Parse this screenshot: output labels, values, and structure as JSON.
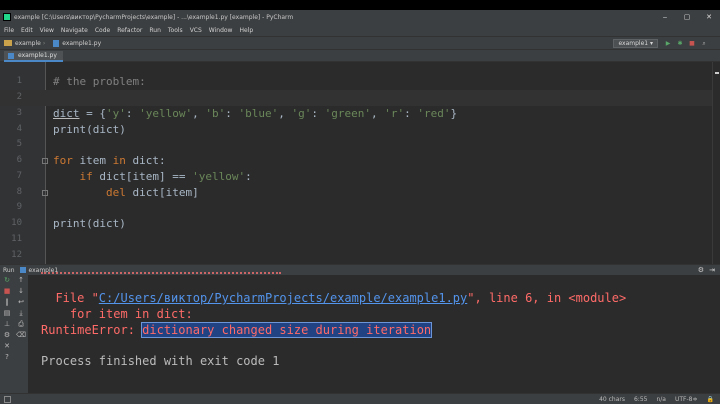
{
  "window": {
    "title": "example [C:\\Users\\виктор\\PycharmProjects\\example] - ...\\example1.py [example] - PyCharm",
    "minimize": "‒",
    "maximize": "▢",
    "close": "✕"
  },
  "menu": [
    "File",
    "Edit",
    "View",
    "Navigate",
    "Code",
    "Refactor",
    "Run",
    "Tools",
    "VCS",
    "Window",
    "Help"
  ],
  "breadcrumb": {
    "project": "example",
    "file": "example1.py"
  },
  "run_config": "example1 ▾",
  "tab": {
    "label": "example1.py"
  },
  "editor": {
    "line_numbers": [
      "1",
      "2",
      "3",
      "4",
      "5",
      "6",
      "7",
      "8",
      "9",
      "10",
      "11",
      "12"
    ],
    "lines": {
      "l1_comment": "# the problem:",
      "l3_var": "dict",
      "l3_eq": " = {",
      "l3_s1": "'y'",
      "l3_c1": ": ",
      "l3_s2": "'yellow'",
      "l3_c2": ", ",
      "l3_s3": "'b'",
      "l3_c3": ": ",
      "l3_s4": "'blue'",
      "l3_c4": ", ",
      "l3_s5": "'g'",
      "l3_c5": ": ",
      "l3_s6": "'green'",
      "l3_c6": ", ",
      "l3_s7": "'r'",
      "l3_c7": ": ",
      "l3_s8": "'red'",
      "l3_end": "}",
      "l4": "print(dict)",
      "l6_for": "for",
      "l6_mid": " item ",
      "l6_in": "in",
      "l6_end": " dict:",
      "l7_if": "    if",
      "l7_mid": " dict[item] == ",
      "l7_str": "'yellow'",
      "l7_end": ":",
      "l8_del": "        del",
      "l8_end": " dict[item]",
      "l10": "print(dict)"
    }
  },
  "run_panel": {
    "label": "Run",
    "config": "example1"
  },
  "console": {
    "file_prefix": "  File \"",
    "file_link": "C:/Users/виктор/PycharmProjects/example/example1.py",
    "file_suffix": "\", line 6, in <module>",
    "code_line": "    for item in dict:",
    "error_name": "RuntimeError: ",
    "error_msg": "dictionary changed size during iteration",
    "exit": "Process finished with exit code 1"
  },
  "status": {
    "chars": "40 chars",
    "position": "6:55",
    "line_sep": "n/a",
    "encoding": "UTF-8≑"
  },
  "colors": {
    "editor_bg": "#2b2b2b",
    "keyword": "#cc7832",
    "string": "#6a8759",
    "comment": "#808080",
    "error": "#ff6b68",
    "link": "#5394ec",
    "selection": "#214283"
  }
}
